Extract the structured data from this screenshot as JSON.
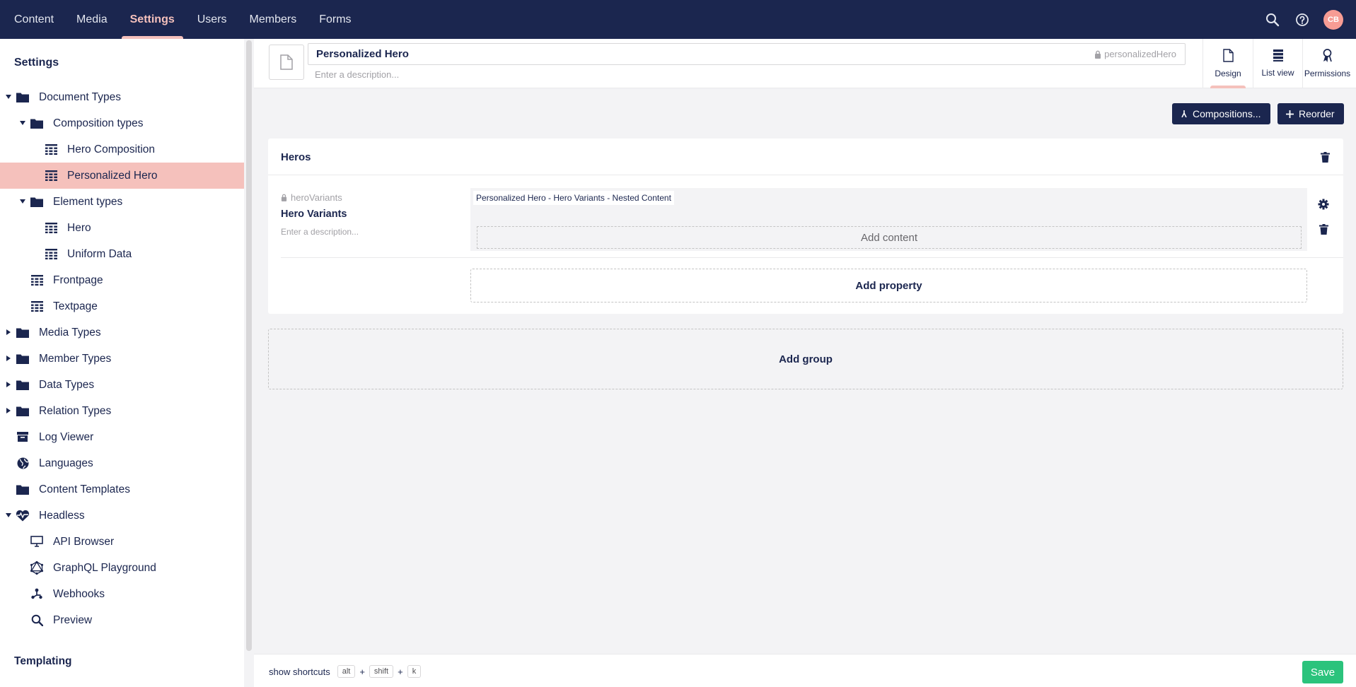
{
  "nav": {
    "items": [
      {
        "label": "Content",
        "active": false
      },
      {
        "label": "Media",
        "active": false
      },
      {
        "label": "Settings",
        "active": true
      },
      {
        "label": "Users",
        "active": false
      },
      {
        "label": "Members",
        "active": false
      },
      {
        "label": "Forms",
        "active": false
      }
    ],
    "user_initials": "CB"
  },
  "sidebar": {
    "heading": "Settings",
    "footer_heading": "Templating",
    "tree": [
      {
        "label": "Document Types",
        "caret": "down",
        "icon": "folder-icon",
        "selected": false
      },
      {
        "label": "Composition types",
        "caret": "down",
        "icon": "folder-icon",
        "selected": false
      },
      {
        "label": "Hero Composition",
        "caret": "",
        "icon": "doctype-icon",
        "selected": false
      },
      {
        "label": "Personalized Hero",
        "caret": "",
        "icon": "doctype-icon",
        "selected": true
      },
      {
        "label": "Element types",
        "caret": "down",
        "icon": "folder-icon",
        "selected": false
      },
      {
        "label": "Hero",
        "caret": "",
        "icon": "doctype-icon",
        "selected": false
      },
      {
        "label": "Uniform Data",
        "caret": "",
        "icon": "doctype-icon",
        "selected": false
      },
      {
        "label": "Frontpage",
        "caret": "",
        "icon": "doctype-icon",
        "selected": false
      },
      {
        "label": "Textpage",
        "caret": "",
        "icon": "doctype-icon",
        "selected": false
      },
      {
        "label": "Media Types",
        "caret": "right",
        "icon": "folder-icon",
        "selected": false
      },
      {
        "label": "Member Types",
        "caret": "right",
        "icon": "folder-icon",
        "selected": false
      },
      {
        "label": "Data Types",
        "caret": "right",
        "icon": "folder-icon",
        "selected": false
      },
      {
        "label": "Relation Types",
        "caret": "right",
        "icon": "folder-icon",
        "selected": false
      },
      {
        "label": "Log Viewer",
        "caret": "",
        "icon": "box-icon",
        "selected": false
      },
      {
        "label": "Languages",
        "caret": "",
        "icon": "globe-icon",
        "selected": false
      },
      {
        "label": "Content Templates",
        "caret": "",
        "icon": "folder-icon",
        "selected": false
      },
      {
        "label": "Headless",
        "caret": "down",
        "icon": "heart-icon",
        "selected": false
      },
      {
        "label": "API Browser",
        "caret": "",
        "icon": "monitor-icon",
        "selected": false
      },
      {
        "label": "GraphQL Playground",
        "caret": "",
        "icon": "graphql-icon",
        "selected": false
      },
      {
        "label": "Webhooks",
        "caret": "",
        "icon": "webhook-icon",
        "selected": false
      },
      {
        "label": "Preview",
        "caret": "",
        "icon": "search-icon",
        "selected": false
      }
    ]
  },
  "editor": {
    "name": "Personalized Hero",
    "alias": "personalizedHero",
    "description_placeholder": "Enter a description...",
    "apps": [
      {
        "label": "Design",
        "icon": "document-icon",
        "active": true
      },
      {
        "label": "List view",
        "icon": "list-icon",
        "active": false
      },
      {
        "label": "Permissions",
        "icon": "ribbon-icon",
        "active": false
      }
    ],
    "compositions_label": "Compositions...",
    "reorder_label": "Reorder"
  },
  "group": {
    "title": "Heros",
    "property": {
      "alias": "heroVariants",
      "name": "Hero Variants",
      "description_placeholder": "Enter a description...",
      "preview_tag": "Personalized Hero - Hero Variants - Nested Content",
      "add_content_label": "Add content"
    },
    "add_property_label": "Add property"
  },
  "add_group_label": "Add group",
  "footer": {
    "shortcuts_label": "show shortcuts",
    "keys": [
      "alt",
      "shift",
      "k"
    ],
    "plus": "+",
    "save_label": "Save"
  },
  "colors": {
    "primary": "#1b264f",
    "accent": "#f5c1bc",
    "success": "#2bc37c"
  }
}
